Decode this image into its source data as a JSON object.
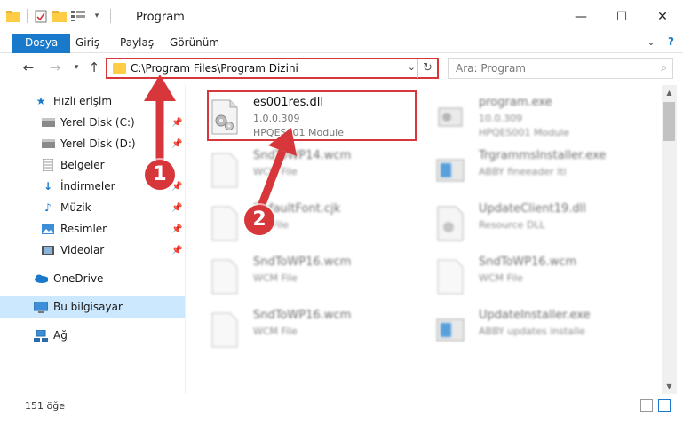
{
  "window": {
    "title": "Program",
    "minimize": "—",
    "maximize": "☐",
    "close": "✕"
  },
  "ribbon": {
    "tabs": [
      "Dosya",
      "Giriş",
      "Paylaş",
      "Görünüm"
    ]
  },
  "address": {
    "path": "C:\\Program Files\\Program Dizini"
  },
  "search": {
    "placeholder": "Ara: Program"
  },
  "sidebar": {
    "items": [
      {
        "label": "Hızlı erişim",
        "icon": "star-icon"
      },
      {
        "label": "Yerel Disk (C:)",
        "icon": "drive-icon"
      },
      {
        "label": "Yerel Disk (D:)",
        "icon": "drive-icon"
      },
      {
        "label": "Belgeler",
        "icon": "documents-icon"
      },
      {
        "label": "İndirmeler",
        "icon": "download-icon"
      },
      {
        "label": "Müzik",
        "icon": "music-icon"
      },
      {
        "label": "Resimler",
        "icon": "pictures-icon"
      },
      {
        "label": "Videolar",
        "icon": "videos-icon"
      },
      {
        "label": "OneDrive",
        "icon": "cloud-icon"
      },
      {
        "label": "Bu bilgisayar",
        "icon": "computer-icon"
      },
      {
        "label": "Ağ",
        "icon": "network-icon"
      }
    ]
  },
  "files": [
    {
      "name": "es001res.dll",
      "line2": "1.0.0.309",
      "line3": "HPQES001 Module"
    },
    {
      "name": "program.exe",
      "line2": "10.0.309",
      "line3": "HPQES001 Module"
    },
    {
      "name": "SndToWP14.wcm",
      "line2": "WCM File",
      "line3": ""
    },
    {
      "name": "TrgrammsInstaller.exe",
      "line2": "ABBY fineeader lti",
      "line3": ""
    },
    {
      "name": "DefaultFont.cjk",
      "line2": "CJK File",
      "line3": ""
    },
    {
      "name": "UpdateClient19.dll",
      "line2": "Resource DLL",
      "line3": ""
    },
    {
      "name": "SndToWP16.wcm",
      "line2": "WCM File",
      "line3": ""
    },
    {
      "name": "SndToWP16.wcm",
      "line2": "WCM File",
      "line3": ""
    },
    {
      "name": "SndToWP16.wcm",
      "line2": "WCM File",
      "line3": ""
    },
    {
      "name": "UpdateInstaller.exe",
      "line2": "ABBY updates installe",
      "line3": ""
    }
  ],
  "status": {
    "count": "151 öğe"
  },
  "annotations": {
    "step1": "1",
    "step2": "2",
    "color": "#d7363a"
  },
  "colors": {
    "accent": "#1979ca",
    "selection": "#cce8ff",
    "folder": "#ffcd45"
  }
}
